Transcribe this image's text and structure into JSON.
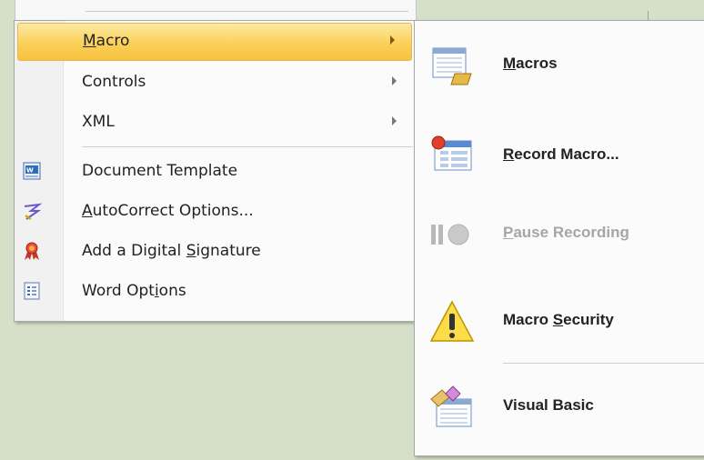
{
  "left_menu": {
    "items": [
      {
        "label": "Macro",
        "has_submenu": true,
        "highlighted": true,
        "icon": ""
      },
      {
        "label": "Controls",
        "has_submenu": true,
        "icon": ""
      },
      {
        "label": "XML",
        "has_submenu": true,
        "icon": ""
      },
      {
        "label": "Document Template",
        "icon": "document-template-icon"
      },
      {
        "label": "AutoCorrect Options...",
        "icon": "autocorrect-icon"
      },
      {
        "label": "Add a Digital Signature",
        "icon": "digital-signature-icon"
      },
      {
        "label": "Word Options",
        "icon": "word-options-icon"
      }
    ]
  },
  "submenu": {
    "items": [
      {
        "label": "Macros",
        "icon": "macros-icon",
        "enabled": true
      },
      {
        "label": "Record Macro...",
        "icon": "record-macro-icon",
        "enabled": true
      },
      {
        "label": "Pause Recording",
        "icon": "pause-recording-icon",
        "enabled": false
      },
      {
        "label": "Macro Security",
        "icon": "warning-icon",
        "enabled": true
      },
      {
        "label": "Visual Basic",
        "icon": "visual-basic-icon",
        "enabled": true
      }
    ]
  },
  "colors": {
    "highlight": "#fbd25e",
    "background": "#d6dfc8",
    "disabled_text": "#a6a6a6"
  }
}
